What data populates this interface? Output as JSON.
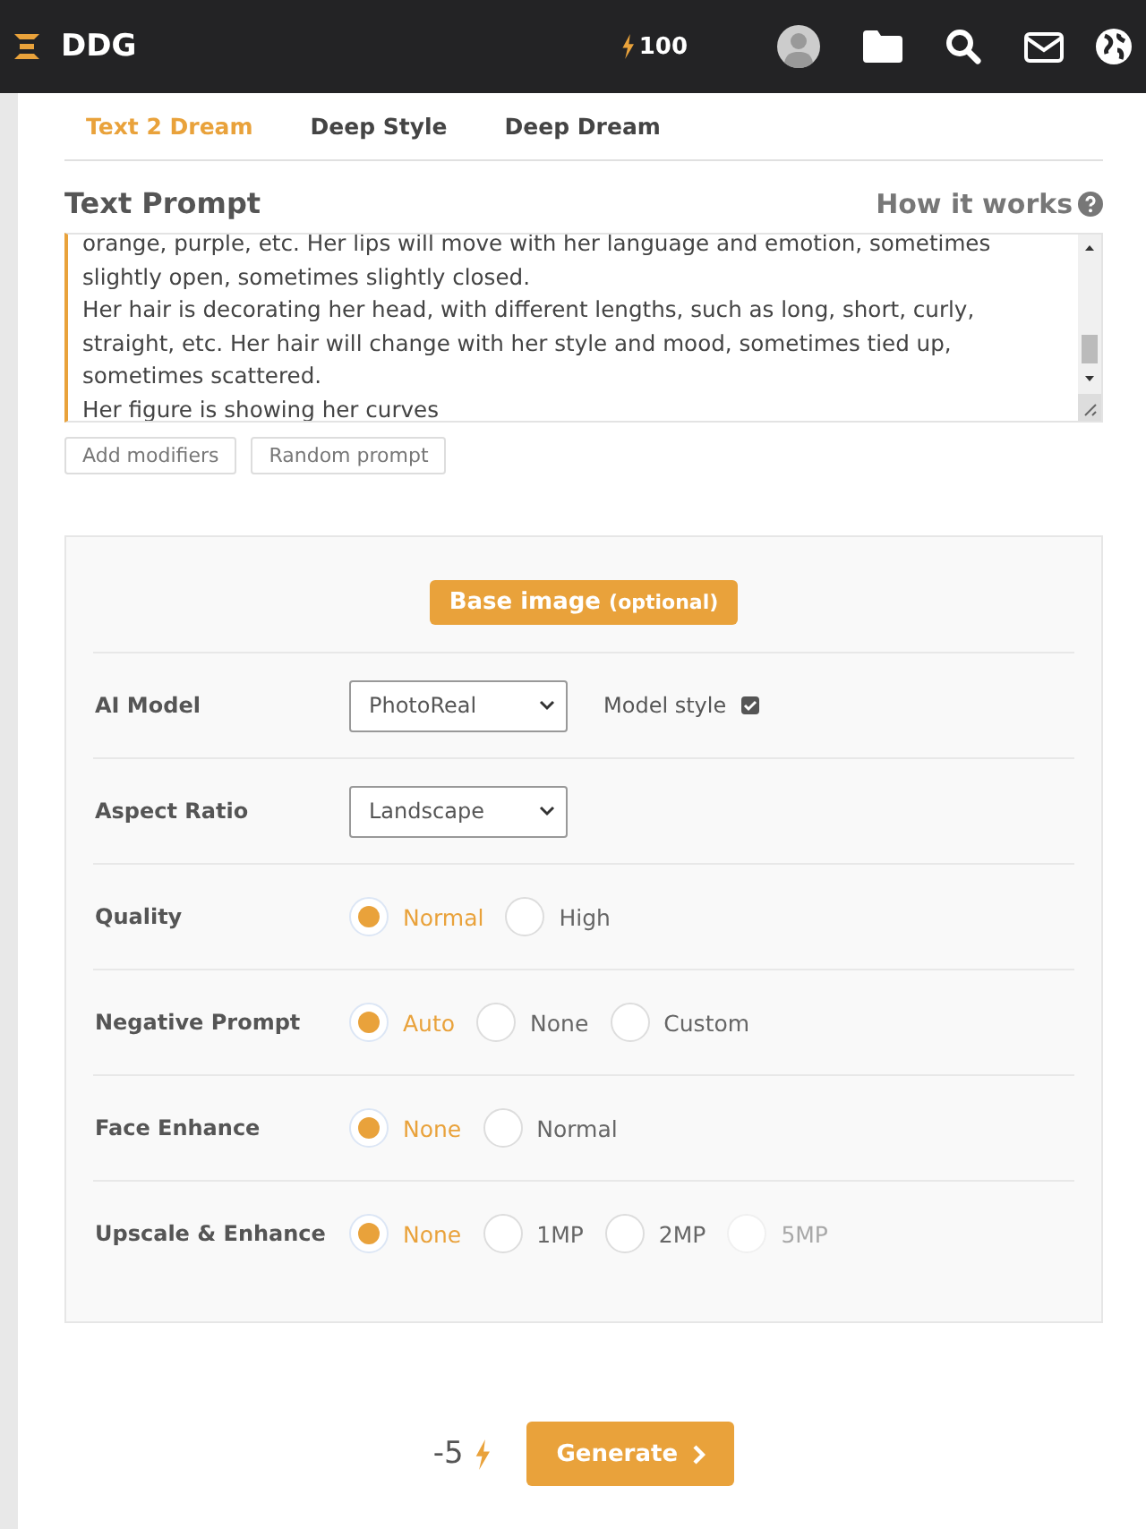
{
  "header": {
    "logo": "DDG",
    "credits": "100"
  },
  "tabs": [
    {
      "label": "Text 2 Dream",
      "selected": true
    },
    {
      "label": "Deep Style",
      "selected": false
    },
    {
      "label": "Deep Dream",
      "selected": false
    }
  ],
  "prompt": {
    "title": "Text Prompt",
    "help_link": "How it works",
    "value": "orange, purple, etc. Her lips will move with her language and emotion, sometimes slightly open, sometimes slightly closed.\nHer hair is decorating her head, with different lengths, such as long, short, curly, straight, etc. Her hair will change with her style and mood, sometimes tied up, sometimes scattered.\nHer figure is showing her curves",
    "buttons": [
      "Add modifiers",
      "Random prompt"
    ]
  },
  "base_image": {
    "label": "Base image",
    "note": "(optional)"
  },
  "settings": [
    {
      "kind": "select",
      "label": "AI Model",
      "value": "PhotoReal",
      "checkbox": {
        "label": "Model style",
        "checked": true
      }
    },
    {
      "kind": "select",
      "label": "Aspect Ratio",
      "value": "Landscape"
    },
    {
      "kind": "radio",
      "label": "Quality",
      "options": [
        {
          "label": "Normal",
          "selected": true,
          "disabled": false
        },
        {
          "label": "High",
          "selected": false,
          "disabled": false
        }
      ]
    },
    {
      "kind": "radio",
      "label": "Negative Prompt",
      "options": [
        {
          "label": "Auto",
          "selected": true,
          "disabled": false
        },
        {
          "label": "None",
          "selected": false,
          "disabled": false
        },
        {
          "label": "Custom",
          "selected": false,
          "disabled": false
        }
      ]
    },
    {
      "kind": "radio",
      "label": "Face Enhance",
      "options": [
        {
          "label": "None",
          "selected": true,
          "disabled": false
        },
        {
          "label": "Normal",
          "selected": false,
          "disabled": false
        }
      ]
    },
    {
      "kind": "radio",
      "label": "Upscale & Enhance",
      "options": [
        {
          "label": "None",
          "selected": true,
          "disabled": false
        },
        {
          "label": "1MP",
          "selected": false,
          "disabled": false
        },
        {
          "label": "2MP",
          "selected": false,
          "disabled": false
        },
        {
          "label": "5MP",
          "selected": false,
          "disabled": true
        }
      ]
    }
  ],
  "generate": {
    "cost": "-5",
    "label": "Generate"
  }
}
